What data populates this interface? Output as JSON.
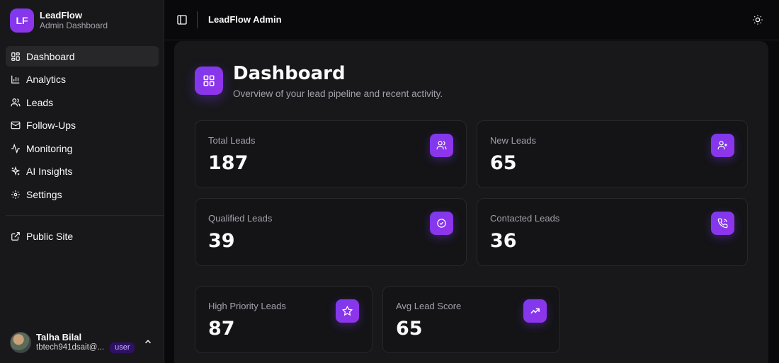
{
  "brand": {
    "logo": "LF",
    "name": "LeadFlow",
    "subtitle": "Admin Dashboard"
  },
  "sidebar": {
    "items": [
      {
        "label": "Dashboard",
        "icon": "dashboard-icon",
        "active": true
      },
      {
        "label": "Analytics",
        "icon": "bar-chart-icon"
      },
      {
        "label": "Leads",
        "icon": "users-icon"
      },
      {
        "label": "Follow-Ups",
        "icon": "mail-icon"
      },
      {
        "label": "Monitoring",
        "icon": "activity-icon"
      },
      {
        "label": "AI Insights",
        "icon": "sparkles-icon"
      },
      {
        "label": "Settings",
        "icon": "gear-icon"
      }
    ],
    "secondary": [
      {
        "label": "Public Site",
        "icon": "external-link-icon"
      }
    ]
  },
  "user": {
    "name": "Talha Bilal",
    "email": "tbtech941dsait@...",
    "role": "user"
  },
  "header": {
    "title": "LeadFlow Admin"
  },
  "page": {
    "title": "Dashboard",
    "subtitle": "Overview of your lead pipeline and recent activity."
  },
  "stats": [
    {
      "label": "Total Leads",
      "value": "187",
      "icon": "users-icon"
    },
    {
      "label": "New Leads",
      "value": "65",
      "icon": "user-plus-icon"
    },
    {
      "label": "Qualified Leads",
      "value": "39",
      "icon": "check-circle-icon"
    },
    {
      "label": "Contacted Leads",
      "value": "36",
      "icon": "phone-call-icon"
    },
    {
      "label": "High Priority Leads",
      "value": "87",
      "icon": "star-icon"
    },
    {
      "label": "Avg Lead Score",
      "value": "65",
      "icon": "trending-up-icon"
    }
  ],
  "colors": {
    "accent": "#7c3aed",
    "background": "#09090b",
    "panel": "#18181b"
  }
}
